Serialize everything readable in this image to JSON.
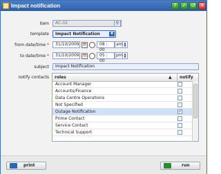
{
  "window": {
    "title": "Impact notification",
    "buttons": [
      "?",
      "✓",
      "↺",
      "✕"
    ]
  },
  "form": {
    "item": {
      "label": "item",
      "value": "AC-02"
    },
    "template": {
      "label": "template",
      "value": "Impact Notification"
    },
    "from": {
      "label": "from date/time",
      "required": "*",
      "date": "31/10/2009",
      "time": "08 : 00",
      "ampm": "am"
    },
    "to": {
      "label": "to date/time",
      "required": "*",
      "date": "31/10/2009",
      "time": "05 : 00",
      "ampm": "pm"
    },
    "subject": {
      "label": "subject",
      "value": "Impact Notification"
    },
    "contacts": {
      "label": "notify contacts"
    }
  },
  "table": {
    "col_roles": "roles",
    "sort_indicator": "▲",
    "col_notify": "notify",
    "rows": [
      {
        "role": "Account Manager",
        "checked": false
      },
      {
        "role": "Accounts/Finance",
        "checked": false
      },
      {
        "role": "Data Centre Operations",
        "checked": false
      },
      {
        "role": "Not Specified",
        "checked": false
      },
      {
        "role": "Outage Notification",
        "checked": true,
        "selected": true
      },
      {
        "role": "Prime Contact",
        "checked": false
      },
      {
        "role": "Service Contact",
        "checked": false
      },
      {
        "role": "Technical Support",
        "checked": false
      }
    ]
  },
  "footer": {
    "print_label": "print",
    "run_label": "run"
  }
}
